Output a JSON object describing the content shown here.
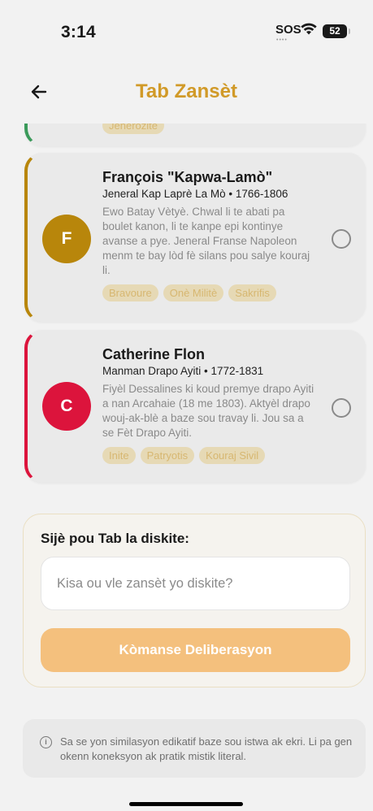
{
  "status": {
    "time": "3:14",
    "sos": "SOS",
    "battery": "52"
  },
  "nav": {
    "title": "Tab Zansèt",
    "back_icon": "arrow-left-icon"
  },
  "previous_tag": "Jenerozite",
  "cards": [
    {
      "initial": "F",
      "color": "#b8860b",
      "name": "François \"Kapwa-Lamò\"",
      "role": "Jeneral Kap Laprè La Mò • 1766-1806",
      "description": "Ewo Batay Vètyè. Chwal li te abati pa boulet kanon, li te kanpe epi kontinye avanse a pye. Jeneral Franse Napoleon menm te bay lòd fè silans pou salye kouraj li.",
      "tags": [
        "Bravoure",
        "Onè Militè",
        "Sakrifis"
      ]
    },
    {
      "initial": "C",
      "color": "#dc143c",
      "name": "Catherine Flon",
      "role": "Manman Drapo Ayiti • 1772-1831",
      "description": "Fiyèl Dessalines ki koud premye drapo Ayiti a nan Arcahaie (18 me 1803). Aktyèl drapo wouj-ak-blè a baze sou travay li. Jou sa a se Fèt Drapo Ayiti.",
      "tags": [
        "Inite",
        "Patryotis",
        "Kouraj Sivil"
      ]
    }
  ],
  "topic": {
    "label": "Sijè pou Tab la diskite:",
    "placeholder": "Kisa ou vle zansèt yo diskite?",
    "button": "Kòmanse Deliberasyon"
  },
  "disclaimer": "Sa se yon similasyon edikatif baze sou istwa ak ekri. Li pa gen okenn koneksyon ak pratik mistik literal.",
  "colors": {
    "accent": "#d19a28",
    "button": "#f4c07d",
    "card_bg": "#eaeaea"
  }
}
